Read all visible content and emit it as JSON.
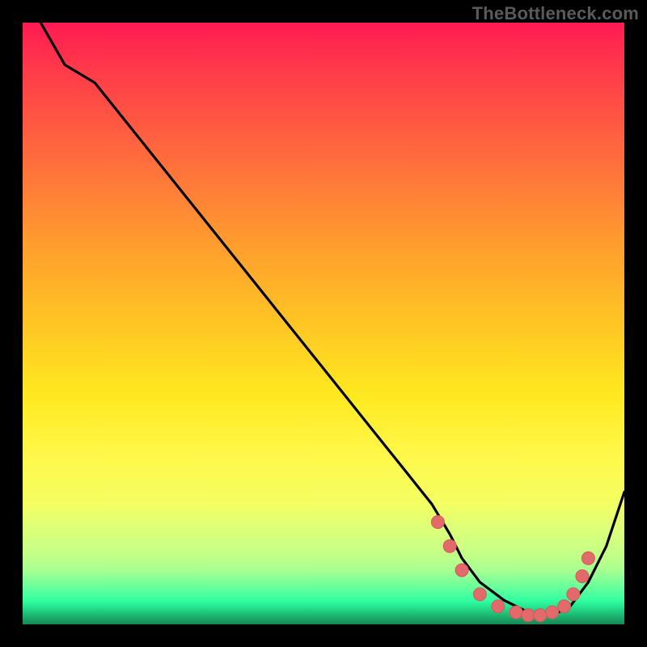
{
  "watermark": "TheBottleneck.com",
  "chart_data": {
    "type": "line",
    "title": "",
    "xlabel": "",
    "ylabel": "",
    "xlim": [
      0,
      100
    ],
    "ylim": [
      0,
      100
    ],
    "series": [
      {
        "name": "curve",
        "x": [
          3,
          7,
          12,
          20,
          30,
          40,
          50,
          58,
          64,
          68,
          71,
          73,
          76,
          80,
          84,
          88,
          91,
          94,
          97,
          100
        ],
        "y": [
          100,
          93,
          90,
          80,
          67.5,
          55,
          42.5,
          32.5,
          25,
          20,
          15,
          11,
          7,
          4,
          2,
          1.5,
          3,
          7,
          13,
          22
        ]
      }
    ],
    "marker_indices": [
      10,
      11,
      12,
      13,
      14,
      15,
      16,
      17
    ],
    "marker_points": [
      {
        "x": 69,
        "y": 17
      },
      {
        "x": 71,
        "y": 13
      },
      {
        "x": 73,
        "y": 9
      },
      {
        "x": 76,
        "y": 5
      },
      {
        "x": 79,
        "y": 3
      },
      {
        "x": 82,
        "y": 2
      },
      {
        "x": 84,
        "y": 1.5
      },
      {
        "x": 86,
        "y": 1.5
      },
      {
        "x": 88,
        "y": 2
      },
      {
        "x": 90,
        "y": 3
      },
      {
        "x": 91.5,
        "y": 5
      },
      {
        "x": 93,
        "y": 8
      },
      {
        "x": 94,
        "y": 11
      }
    ],
    "colors": {
      "curve": "#000000",
      "marker_fill": "#e26a6a",
      "marker_stroke": "#d15a5a"
    }
  }
}
